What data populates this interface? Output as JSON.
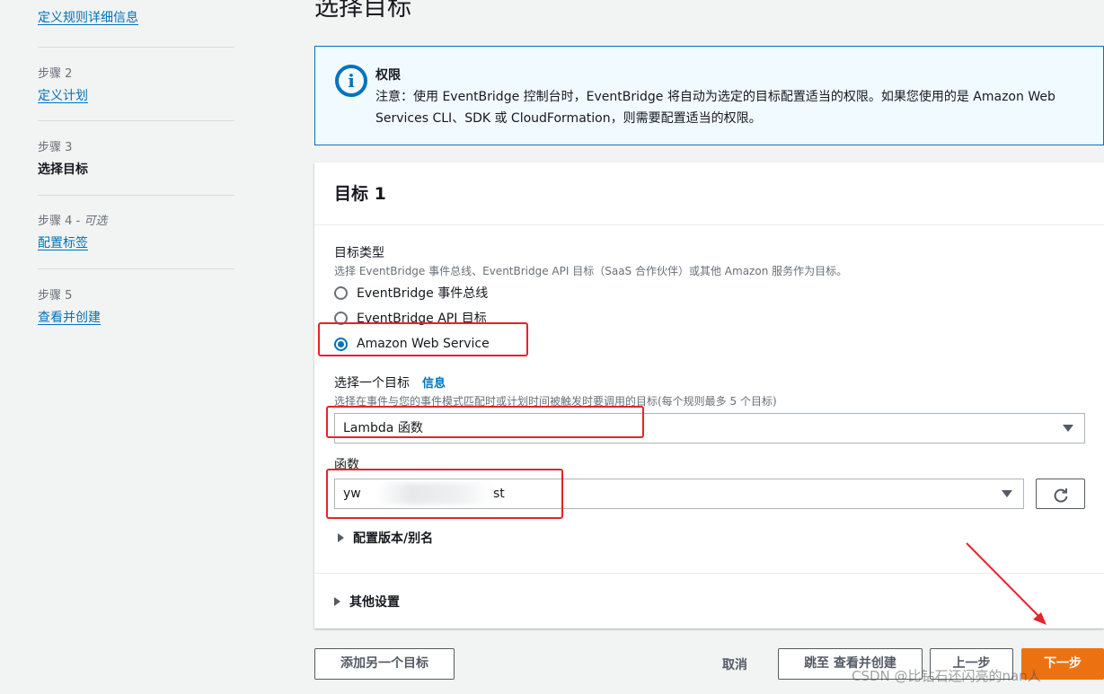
{
  "steps": [
    {
      "num": "",
      "label": "定义规则详细信息",
      "state": "link"
    },
    {
      "num": "步骤 2",
      "label": "定义计划",
      "state": "link"
    },
    {
      "num": "步骤 3",
      "label": "选择目标",
      "state": "current"
    },
    {
      "num": "步骤 4",
      "num_optional": " - 可选",
      "label": "配置标签",
      "state": "link"
    },
    {
      "num": "步骤 5",
      "label": "查看并创建",
      "state": "link"
    }
  ],
  "page_title": "选择目标",
  "info_box": {
    "icon": "info-icon",
    "title": "权限",
    "body": "注意：使用 EventBridge 控制台时，EventBridge 将自动为选定的目标配置适当的权限。如果您使用的是 Amazon Web Services CLI、SDK 或 CloudFormation，则需要配置适当的权限。"
  },
  "target": {
    "title": "目标 1",
    "target_type": {
      "label": "目标类型",
      "description": "选择 EventBridge 事件总线、EventBridge API 目标（SaaS 合作伙伴）或其他 Amazon 服务作为目标。",
      "options": [
        "EventBridge 事件总线",
        "EventBridge API 目标",
        "Amazon Web Service"
      ],
      "selected": "Amazon Web Service"
    },
    "select_target": {
      "label": "选择一个目标",
      "info_link": "信息",
      "description": "选择在事件与您的事件模式匹配时或计划时间被触发时要调用的目标(每个规则最多 5 个目标)",
      "value": "Lambda 函数"
    },
    "function": {
      "label": "函数",
      "value_start": "yw",
      "value_end": "st"
    },
    "version_alias": "配置版本/别名",
    "other_settings": "其他设置"
  },
  "footer": {
    "add_target": "添加另一个目标",
    "cancel": "取消",
    "skip_review": "跳至 查看并创建",
    "previous": "上一步",
    "next": "下一步"
  },
  "watermark": "CSDN @比钻石还闪亮的nan人",
  "colors": {
    "accent": "#0073bb",
    "primary_button": "#ec7211",
    "highlight": "#e5232b"
  }
}
